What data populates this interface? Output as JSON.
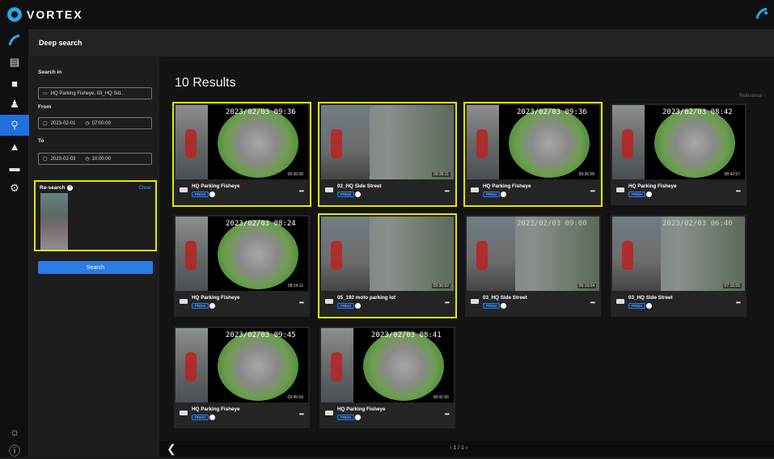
{
  "app": {
    "brand": "VORTEX"
  },
  "header": {
    "title": "Deep search"
  },
  "sidebar": {
    "items": [
      {
        "icon": "layout-icon",
        "active": false
      },
      {
        "icon": "video-icon",
        "active": false
      },
      {
        "icon": "user-icon",
        "active": false
      },
      {
        "icon": "search-icon",
        "active": true
      },
      {
        "icon": "bell-icon",
        "active": false
      },
      {
        "icon": "archive-icon",
        "active": false
      },
      {
        "icon": "gear-icon",
        "active": false
      }
    ],
    "bottom": [
      "sun-icon",
      "help-icon"
    ]
  },
  "search_panel": {
    "search_in_label": "Search in",
    "search_in_value": "HQ Parking Fisheye, 03_HQ Sid...",
    "from_label": "From",
    "from_date": "2023-02-01",
    "from_time": "07:00:00",
    "to_label": "To",
    "to_date": "2023-02-03",
    "to_time": "10:00:00",
    "research_label": "Re-search",
    "clear_label": "Clear",
    "search_button": "Search"
  },
  "results": {
    "count_label": "10 Results",
    "sort_label": "Relevance ↑",
    "cards": [
      {
        "name": "HQ Parking Fisheye",
        "timestamp": "2023/02/03 09:36",
        "duration": "09:36:58",
        "badge": "PREM",
        "highlighted": true
      },
      {
        "name": "02_HQ Side Street",
        "timestamp": "",
        "duration": "09:36:11",
        "badge": "PREM",
        "highlighted": true
      },
      {
        "name": "HQ Parking Fisheye",
        "timestamp": "2023/02/03 09:36",
        "duration": "09:36:58",
        "badge": "PREM",
        "highlighted": true
      },
      {
        "name": "HQ Parking Fisheye",
        "timestamp": "2023/02/03 08:42",
        "duration": "08:42:57",
        "badge": "PREM",
        "highlighted": false
      },
      {
        "name": "HQ Parking Fisheye",
        "timestamp": "2023/02/03 08:24",
        "duration": "08:24:11",
        "badge": "PREM",
        "highlighted": false
      },
      {
        "name": "05_192 moto parking lot",
        "timestamp": "",
        "duration": "09:36:52",
        "badge": "PREM",
        "highlighted": true
      },
      {
        "name": "03_HQ Side Street",
        "timestamp": "2023/02/03 09:00",
        "duration": "09:19:04",
        "badge": "PREM",
        "highlighted": false
      },
      {
        "name": "03_HQ Side Street",
        "timestamp": "2023/02/03 06:40",
        "duration": "07:16:55",
        "badge": "PREM",
        "highlighted": false
      },
      {
        "name": "HQ Parking Fisheye",
        "timestamp": "2023/02/03 09:45",
        "duration": "09:45:59",
        "badge": "PREM",
        "highlighted": false
      },
      {
        "name": "HQ Parking Fisheye",
        "timestamp": "2023/02/03 08:41",
        "duration": "08:41:56",
        "badge": "PREM",
        "highlighted": false
      }
    ]
  },
  "footer": {
    "page": "1 / 1"
  }
}
